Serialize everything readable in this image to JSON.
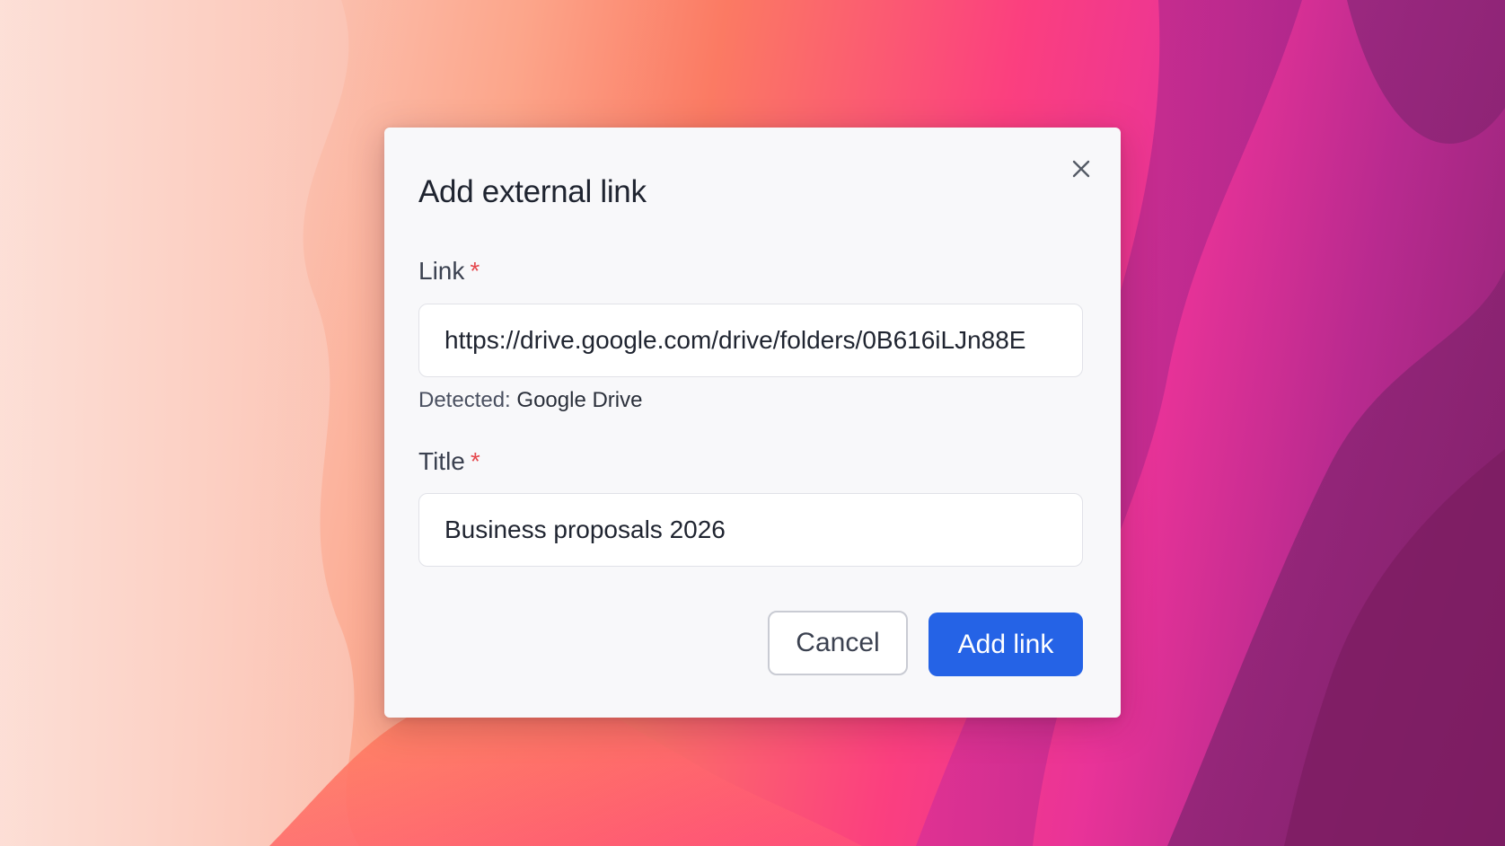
{
  "dialog": {
    "title": "Add external link",
    "close_icon": "close-icon"
  },
  "fields": {
    "link": {
      "label": "Link",
      "required_marker": "*",
      "value": "https://drive.google.com/drive/folders/0B616iLJn88E"
    },
    "detected": {
      "prefix": "Detected:",
      "service": "Google Drive"
    },
    "title": {
      "label": "Title",
      "required_marker": "*",
      "value": "Business proposals 2026"
    }
  },
  "actions": {
    "cancel_label": "Cancel",
    "submit_label": "Add link"
  },
  "colors": {
    "primary": "#2563e6",
    "required": "#e5484d",
    "dialog_bg": "#f8f8fa"
  }
}
